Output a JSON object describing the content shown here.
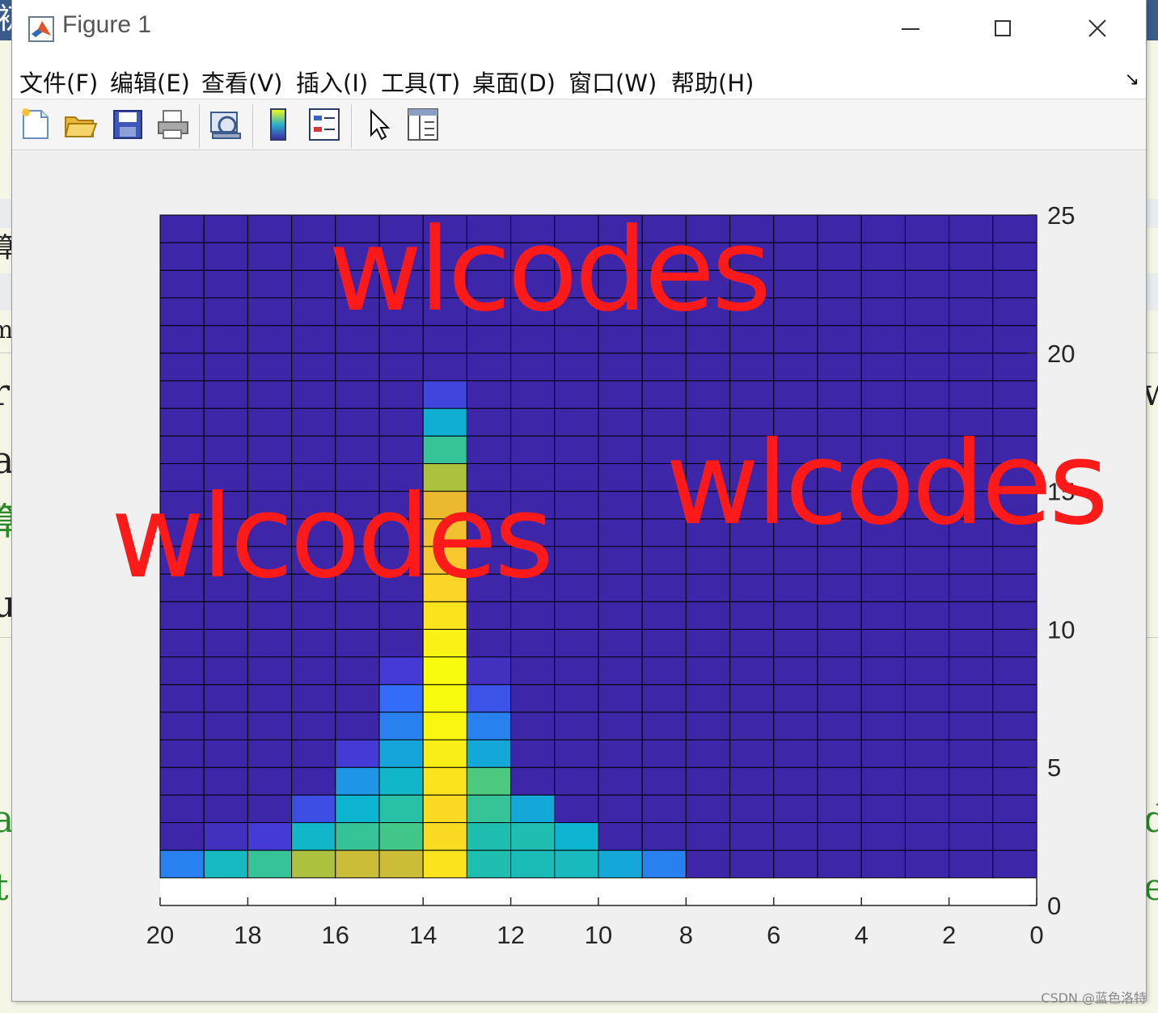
{
  "window": {
    "title": "Figure 1",
    "menu": [
      "文件(F)",
      "编辑(E)",
      "查看(V)",
      "插入(I)",
      "工具(T)",
      "桌面(D)",
      "窗口(W)",
      "帮助(H)"
    ],
    "toolbar": [
      "new-figure",
      "open-file",
      "save",
      "print",
      "print-preview",
      "insert-colorbar",
      "insert-legend",
      "edit-plot",
      "property-inspector"
    ]
  },
  "background_text": {
    "top_left": "初",
    "side_left": [
      "算",
      "m",
      "r",
      "a",
      "算",
      "u",
      "a",
      "t"
    ],
    "side_right": [
      "w",
      "d",
      "e"
    ]
  },
  "watermarks": [
    "wlcodes",
    "wlcodes",
    "wlcodes"
  ],
  "credit": "CSDN @蓝色洛特",
  "chart_data": {
    "type": "heatmap",
    "title": "",
    "xlabel": "",
    "ylabel": "",
    "xlim": [
      20,
      0
    ],
    "ylim": [
      0,
      25
    ],
    "x_direction": "reversed",
    "y_axis_location": "right",
    "xticks": [
      20,
      18,
      16,
      14,
      12,
      10,
      8,
      6,
      4,
      2,
      0
    ],
    "yticks": [
      0,
      5,
      10,
      15,
      20,
      25
    ],
    "x_edges": [
      20,
      19,
      18,
      17,
      16,
      15,
      14,
      13,
      12,
      11,
      10,
      9,
      8,
      7,
      6,
      5,
      4,
      3,
      2,
      1
    ],
    "y_edges": [
      1,
      25
    ],
    "grid": true,
    "colormap": "parula",
    "column_values_bottom_to_top": [
      {
        "x_left": 20,
        "values": [
          0.25
        ]
      },
      {
        "x_left": 19,
        "values": [
          0.45,
          0.05
        ]
      },
      {
        "x_left": 18,
        "values": [
          0.55,
          0.1
        ]
      },
      {
        "x_left": 17,
        "values": [
          0.72,
          0.42,
          0.14
        ]
      },
      {
        "x_left": 16,
        "values": [
          0.76,
          0.55,
          0.4,
          0.3,
          0.1
        ]
      },
      {
        "x_left": 15,
        "values": [
          0.76,
          0.58,
          0.52,
          0.42,
          0.35,
          0.25,
          0.2,
          0.1
        ]
      },
      {
        "x_left": 14,
        "values": [
          0.95,
          0.93,
          0.93,
          0.95,
          0.97,
          0.99,
          1.0,
          1.0,
          0.98,
          0.95,
          0.92,
          0.88,
          0.84,
          0.8,
          0.72,
          0.55,
          0.38,
          0.12
        ]
      },
      {
        "x_left": 13,
        "values": [
          0.5,
          0.5,
          0.55,
          0.6,
          0.36,
          0.25,
          0.15,
          0.05
        ]
      },
      {
        "x_left": 12,
        "values": [
          0.48,
          0.5,
          0.36
        ]
      },
      {
        "x_left": 11,
        "values": [
          0.46,
          0.4
        ]
      },
      {
        "x_left": 10,
        "values": [
          0.36
        ]
      },
      {
        "x_left": 9,
        "values": [
          0.25
        ]
      }
    ]
  }
}
